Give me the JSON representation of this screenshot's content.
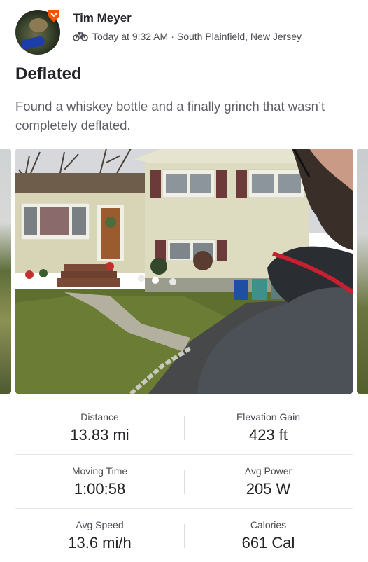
{
  "activity": {
    "user_name": "Tim Meyer",
    "activity_icon": "bike-icon",
    "timestamp": "Today at 9:32 AM",
    "separator": "·",
    "location": "South Plainfield, New Jersey",
    "title": "Deflated",
    "description": "Found a whiskey bottle and a finally grinch that wasn’t completely deflated."
  },
  "colors": {
    "brand_orange": "#fc5200",
    "text_primary": "#242428",
    "text_secondary": "#494950",
    "divider": "#e6e6ea"
  },
  "stats": [
    {
      "left": {
        "label": "Distance",
        "value": "13.83 mi"
      },
      "right": {
        "label": "Elevation Gain",
        "value": "423 ft"
      }
    },
    {
      "left": {
        "label": "Moving Time",
        "value": "1:00:58"
      },
      "right": {
        "label": "Avg Power",
        "value": "205 W"
      }
    },
    {
      "left": {
        "label": "Avg Speed",
        "value": "13.6 mi/h"
      },
      "right": {
        "label": "Calories",
        "value": "661 Cal"
      }
    }
  ]
}
